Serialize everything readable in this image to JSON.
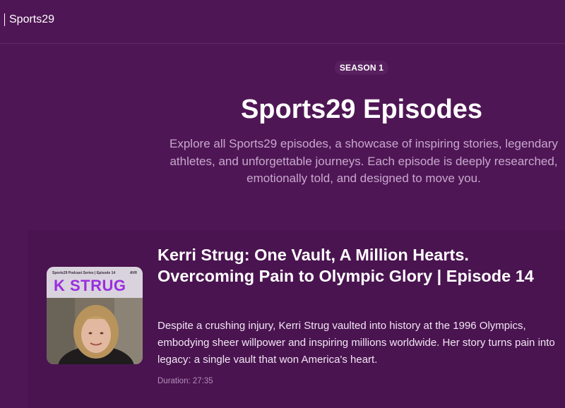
{
  "header": {
    "brand": "Sports29"
  },
  "hero": {
    "badge": "SEASON 1",
    "title": "Sports29 Episodes",
    "intro_lines": [
      "Explore all Sports29 episodes, a showcase of inspiring stories, legendary",
      "athletes, and unforgettable journeys. Each episode is deeply researched,",
      "emotionally told, and designed to move you."
    ]
  },
  "episodes": [
    {
      "thumbnail": {
        "series_text": "Sports29 Podcast Series | Episode 14",
        "tag": "AVR",
        "name": "K STRUG"
      },
      "title": "Kerri Strug: One Vault, A Million Hearts. Overcoming Pain to Olympic Glory | Episode 14",
      "description": "Despite a crushing injury, Kerri Strug vaulted into history at the 1996 Olympics, embodying sheer willpower and inspiring millions worldwide. Her story turns pain into legacy: a single vault that won America's heart.",
      "duration": "Duration: 27:35"
    }
  ],
  "colors": {
    "background": "#4f1655",
    "card": "#4a1450",
    "muted_text": "#c7a8cd",
    "thumbnail_accent": "#9a2de0"
  }
}
